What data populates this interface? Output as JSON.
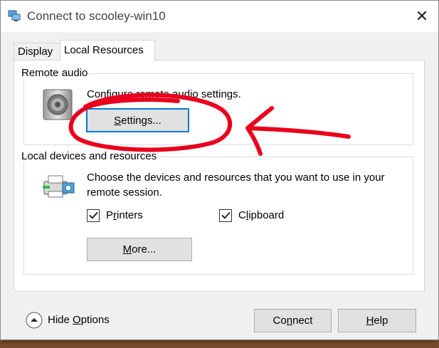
{
  "window": {
    "title": "Connect to scooley-win10",
    "close_glyph": "✕",
    "icon": "remote-desktop-icon"
  },
  "tabs": [
    {
      "label": "Display",
      "active": false
    },
    {
      "label": "Local Resources",
      "active": true
    }
  ],
  "remote_audio": {
    "legend": "Remote audio",
    "description": "Configure remote audio settings.",
    "settings_button": {
      "accel": "S",
      "rest": "ettings..."
    },
    "icon": "speaker-icon"
  },
  "local_devices": {
    "legend": "Local devices and resources",
    "description": "Choose the devices and resources that you want to use in your remote session.",
    "printers": {
      "accel": "",
      "pre": "P",
      "u": "r",
      "post": "inters",
      "checked": true
    },
    "clipboard": {
      "pre": "C",
      "u": "l",
      "post": "ipboard",
      "checked": true
    },
    "more_button": {
      "accel": "M",
      "rest": "ore..."
    },
    "icon": "printer-devices-icon"
  },
  "footer": {
    "hide_options": {
      "pre": "Hide ",
      "u": "O",
      "post": "ptions"
    },
    "connect": {
      "pre": "Co",
      "u": "n",
      "post": "nect"
    },
    "help": {
      "u": "H",
      "post": "elp"
    }
  },
  "colors": {
    "accent": "#0078d7",
    "annotation": "#e8001c"
  }
}
